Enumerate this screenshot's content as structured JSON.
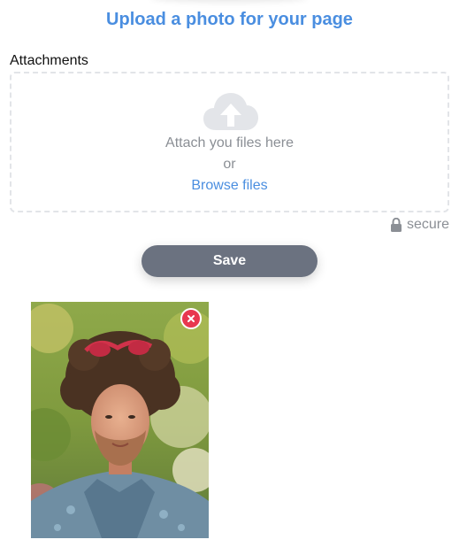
{
  "page": {
    "title": "Upload a photo for your page"
  },
  "attachments": {
    "label": "Attachments",
    "dropzone": {
      "icon": "cloud-upload-icon",
      "attach_text": "Attach you files here",
      "or_text": "or",
      "browse_label": "Browse files"
    },
    "secure": {
      "icon": "lock-icon",
      "label": "secure"
    }
  },
  "actions": {
    "save_label": "Save"
  },
  "preview": {
    "remove_icon": "close-icon",
    "image": "uploaded-portrait-photo"
  },
  "colors": {
    "accent": "#4a8ee0",
    "muted_text": "#8b8f95",
    "button_bg": "#6b7280",
    "remove_red": "#e8384f",
    "dropzone_border": "#e2e4e8"
  }
}
